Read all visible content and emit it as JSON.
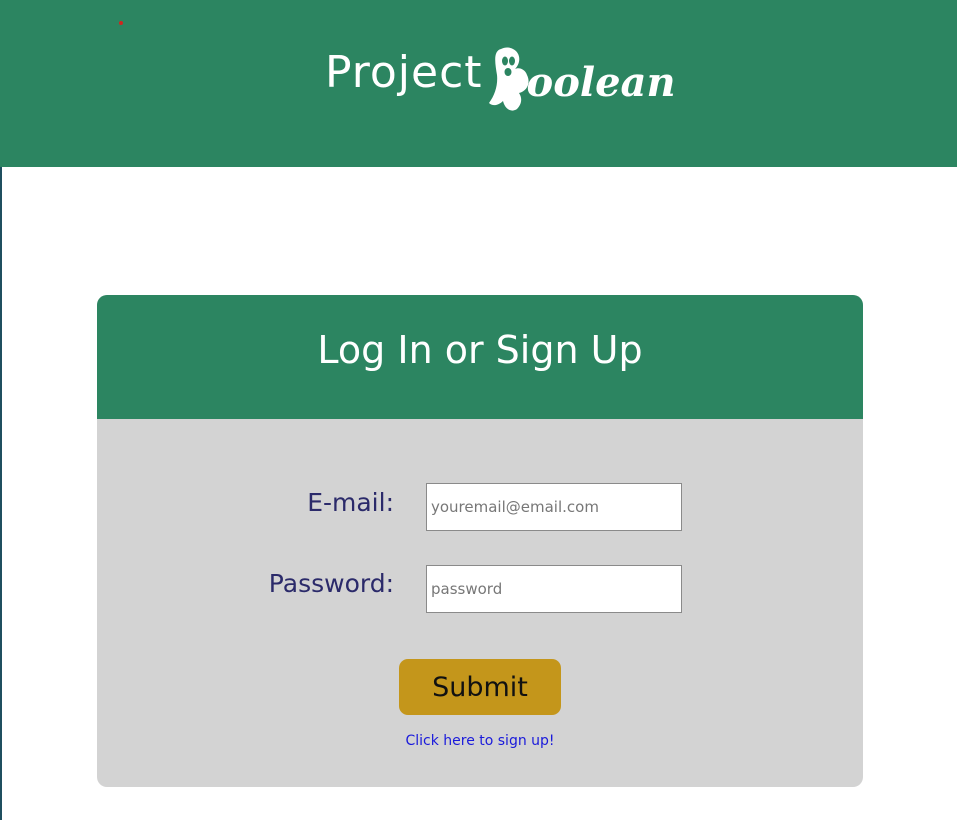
{
  "header": {
    "brand_project": "Project",
    "brand_boolean": "Boolean",
    "colors": {
      "header_bg": "#2c8561",
      "text": "#ffffff"
    }
  },
  "login_card": {
    "title": "Log In or Sign Up",
    "email": {
      "label": "E-mail:",
      "placeholder": "youremail@email.com",
      "value": ""
    },
    "password": {
      "label": "Password:",
      "placeholder": "password",
      "value": ""
    },
    "submit_label": "Submit",
    "signup_link": "Click here to sign up!",
    "colors": {
      "card_head": "#2c8561",
      "card_body": "#d3d3d3",
      "label": "#2b2a6a",
      "submit": "#c4961b",
      "link": "#1a1adb"
    }
  }
}
